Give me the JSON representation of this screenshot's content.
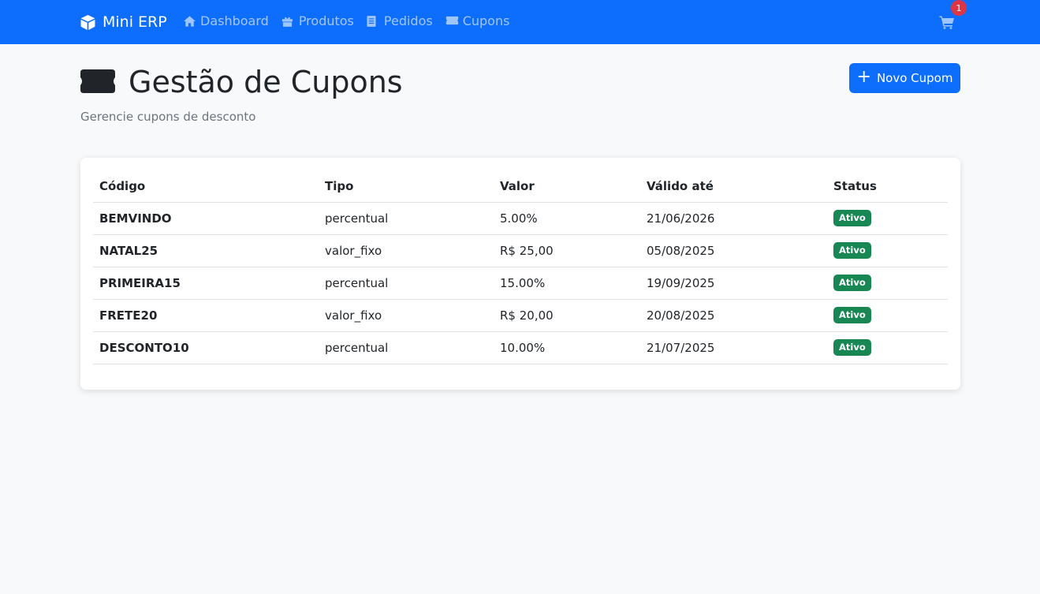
{
  "colors": {
    "primary": "#0d6efd",
    "success": "#198754",
    "danger": "#dc3545"
  },
  "navbar": {
    "brand": {
      "label": "Mini ERP",
      "icon": "box-icon"
    },
    "links": [
      {
        "label": "Dashboard",
        "icon": "home-icon"
      },
      {
        "label": "Produtos",
        "icon": "gift-icon"
      },
      {
        "label": "Pedidos",
        "icon": "document-icon"
      },
      {
        "label": "Cupons",
        "icon": "ticket-icon"
      }
    ],
    "cart": {
      "icon": "cart-icon",
      "count": "1"
    }
  },
  "header": {
    "icon": "ticket-icon",
    "title": "Gestão de Cupons",
    "subtitle": "Gerencie cupons de desconto",
    "new_button": "Novo Cupom"
  },
  "table": {
    "headers": [
      "Código",
      "Tipo",
      "Valor",
      "Válido até",
      "Status"
    ],
    "rows": [
      {
        "code": "BEMVINDO",
        "type": "percentual",
        "value": "5.00%",
        "valid_until": "21/06/2026",
        "status": "Ativo"
      },
      {
        "code": "NATAL25",
        "type": "valor_fixo",
        "value": "R$ 25,00",
        "valid_until": "05/08/2025",
        "status": "Ativo"
      },
      {
        "code": "PRIMEIRA15",
        "type": "percentual",
        "value": "15.00%",
        "valid_until": "19/09/2025",
        "status": "Ativo"
      },
      {
        "code": "FRETE20",
        "type": "valor_fixo",
        "value": "R$ 20,00",
        "valid_until": "20/08/2025",
        "status": "Ativo"
      },
      {
        "code": "DESCONTO10",
        "type": "percentual",
        "value": "10.00%",
        "valid_until": "21/07/2025",
        "status": "Ativo"
      }
    ]
  }
}
